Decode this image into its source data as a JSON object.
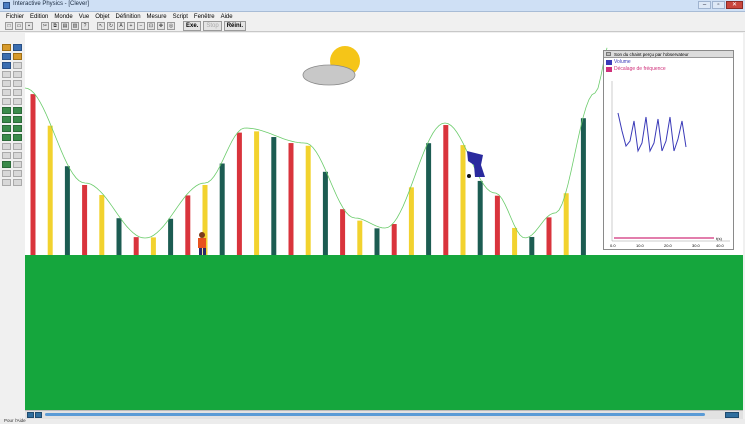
{
  "window": {
    "title": "Interactive Physics - [Clever]"
  },
  "menubar": {
    "items": [
      "Fichier",
      "Edition",
      "Monde",
      "Vue",
      "Objet",
      "Définition",
      "Mesure",
      "Script",
      "Fenêtre",
      "Aide"
    ]
  },
  "toolbar": {
    "run_label": "Exe.",
    "stop_label": "Stop",
    "reset_label": "Réini."
  },
  "graph": {
    "title": "Son du chaint perçu par l'observateur",
    "legend": [
      {
        "name": "Volume",
        "color": "#3a3ab8"
      },
      {
        "name": "Décalage de fréquence",
        "color": "#d0307a"
      }
    ],
    "x_ticks": [
      "0.0",
      "10.0",
      "20.0",
      "30.0",
      "40.0"
    ],
    "x_unit": "t(s)"
  },
  "scene": {
    "bar_colors": [
      "#d9343c",
      "#f2d22e",
      "#1c5c52"
    ],
    "ground_color": "#15a63d",
    "wave_color": "#6ccc6c"
  },
  "status": {
    "text": "Pour l'Aide"
  }
}
